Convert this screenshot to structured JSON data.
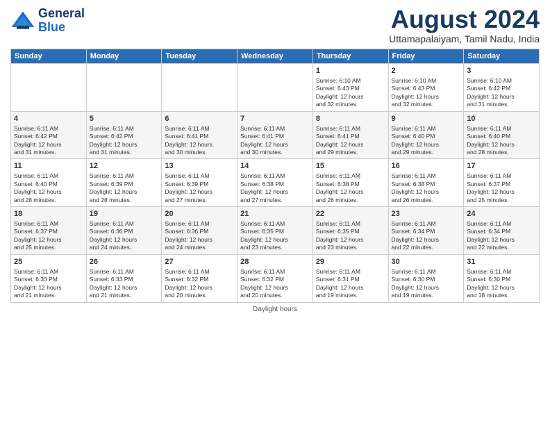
{
  "header": {
    "logo_line1": "General",
    "logo_line2": "Blue",
    "month_year": "August 2024",
    "location": "Uttamapalaiyam, Tamil Nadu, India"
  },
  "days_of_week": [
    "Sunday",
    "Monday",
    "Tuesday",
    "Wednesday",
    "Thursday",
    "Friday",
    "Saturday"
  ],
  "weeks": [
    [
      {
        "day": "",
        "info": ""
      },
      {
        "day": "",
        "info": ""
      },
      {
        "day": "",
        "info": ""
      },
      {
        "day": "",
        "info": ""
      },
      {
        "day": "1",
        "info": "Sunrise: 6:10 AM\nSunset: 6:43 PM\nDaylight: 12 hours\nand 32 minutes."
      },
      {
        "day": "2",
        "info": "Sunrise: 6:10 AM\nSunset: 6:43 PM\nDaylight: 12 hours\nand 32 minutes."
      },
      {
        "day": "3",
        "info": "Sunrise: 6:10 AM\nSunset: 6:42 PM\nDaylight: 12 hours\nand 31 minutes."
      }
    ],
    [
      {
        "day": "4",
        "info": "Sunrise: 6:11 AM\nSunset: 6:42 PM\nDaylight: 12 hours\nand 31 minutes."
      },
      {
        "day": "5",
        "info": "Sunrise: 6:11 AM\nSunset: 6:42 PM\nDaylight: 12 hours\nand 31 minutes."
      },
      {
        "day": "6",
        "info": "Sunrise: 6:11 AM\nSunset: 6:41 PM\nDaylight: 12 hours\nand 30 minutes."
      },
      {
        "day": "7",
        "info": "Sunrise: 6:11 AM\nSunset: 6:41 PM\nDaylight: 12 hours\nand 30 minutes."
      },
      {
        "day": "8",
        "info": "Sunrise: 6:11 AM\nSunset: 6:41 PM\nDaylight: 12 hours\nand 29 minutes."
      },
      {
        "day": "9",
        "info": "Sunrise: 6:11 AM\nSunset: 6:40 PM\nDaylight: 12 hours\nand 29 minutes."
      },
      {
        "day": "10",
        "info": "Sunrise: 6:11 AM\nSunset: 6:40 PM\nDaylight: 12 hours\nand 28 minutes."
      }
    ],
    [
      {
        "day": "11",
        "info": "Sunrise: 6:11 AM\nSunset: 6:40 PM\nDaylight: 12 hours\nand 28 minutes."
      },
      {
        "day": "12",
        "info": "Sunrise: 6:11 AM\nSunset: 6:39 PM\nDaylight: 12 hours\nand 28 minutes."
      },
      {
        "day": "13",
        "info": "Sunrise: 6:11 AM\nSunset: 6:39 PM\nDaylight: 12 hours\nand 27 minutes."
      },
      {
        "day": "14",
        "info": "Sunrise: 6:11 AM\nSunset: 6:38 PM\nDaylight: 12 hours\nand 27 minutes."
      },
      {
        "day": "15",
        "info": "Sunrise: 6:11 AM\nSunset: 6:38 PM\nDaylight: 12 hours\nand 26 minutes."
      },
      {
        "day": "16",
        "info": "Sunrise: 6:11 AM\nSunset: 6:38 PM\nDaylight: 12 hours\nand 26 minutes."
      },
      {
        "day": "17",
        "info": "Sunrise: 6:11 AM\nSunset: 6:37 PM\nDaylight: 12 hours\nand 25 minutes."
      }
    ],
    [
      {
        "day": "18",
        "info": "Sunrise: 6:11 AM\nSunset: 6:37 PM\nDaylight: 12 hours\nand 25 minutes."
      },
      {
        "day": "19",
        "info": "Sunrise: 6:11 AM\nSunset: 6:36 PM\nDaylight: 12 hours\nand 24 minutes."
      },
      {
        "day": "20",
        "info": "Sunrise: 6:11 AM\nSunset: 6:36 PM\nDaylight: 12 hours\nand 24 minutes."
      },
      {
        "day": "21",
        "info": "Sunrise: 6:11 AM\nSunset: 6:35 PM\nDaylight: 12 hours\nand 23 minutes."
      },
      {
        "day": "22",
        "info": "Sunrise: 6:11 AM\nSunset: 6:35 PM\nDaylight: 12 hours\nand 23 minutes."
      },
      {
        "day": "23",
        "info": "Sunrise: 6:11 AM\nSunset: 6:34 PM\nDaylight: 12 hours\nand 22 minutes."
      },
      {
        "day": "24",
        "info": "Sunrise: 6:11 AM\nSunset: 6:34 PM\nDaylight: 12 hours\nand 22 minutes."
      }
    ],
    [
      {
        "day": "25",
        "info": "Sunrise: 6:11 AM\nSunset: 6:33 PM\nDaylight: 12 hours\nand 21 minutes."
      },
      {
        "day": "26",
        "info": "Sunrise: 6:11 AM\nSunset: 6:33 PM\nDaylight: 12 hours\nand 21 minutes."
      },
      {
        "day": "27",
        "info": "Sunrise: 6:11 AM\nSunset: 6:32 PM\nDaylight: 12 hours\nand 20 minutes."
      },
      {
        "day": "28",
        "info": "Sunrise: 6:11 AM\nSunset: 6:32 PM\nDaylight: 12 hours\nand 20 minutes."
      },
      {
        "day": "29",
        "info": "Sunrise: 6:11 AM\nSunset: 6:31 PM\nDaylight: 12 hours\nand 19 minutes."
      },
      {
        "day": "30",
        "info": "Sunrise: 6:11 AM\nSunset: 6:30 PM\nDaylight: 12 hours\nand 19 minutes."
      },
      {
        "day": "31",
        "info": "Sunrise: 6:11 AM\nSunset: 6:30 PM\nDaylight: 12 hours\nand 18 minutes."
      }
    ]
  ],
  "footer": "Daylight hours"
}
